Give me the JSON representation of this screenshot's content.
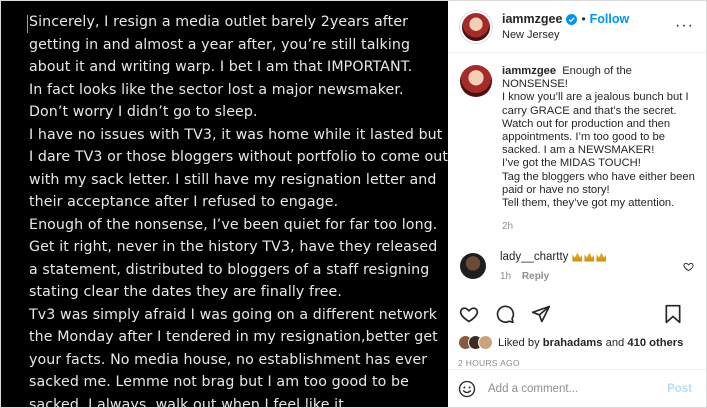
{
  "post_image": {
    "text": "Sincerely, I resign a media outlet barely 2years after getting in and almost a year after, you’re still talking about it and writing warp. I bet I am that IMPORTANT.\nIn fact looks like the sector lost a major newsmaker.\nDon’t worry I didn’t go to sleep.\nI have no issues with TV3, it was home while it lasted but I dare TV3 or those bloggers without portfolio to come out with my sack letter. I still have my resignation letter and their acceptance after I refused to engage.\nEnough of the nonsense, I’ve been quiet for far too long. Get it right, never in the history TV3, have they released a statement, distributed to bloggers of a staff resigning stating clear the dates they are finally free.\nTv3 was simply afraid I was going on a different network the Monday after I tendered in my resignation,better get your facts. No media house, no establishment has ever sacked me. Lemme not brag but I am too good to be sacked. I always, walk out when I feel like it."
  },
  "header": {
    "username": "iammzgee",
    "separator": "•",
    "follow_label": "Follow",
    "location": "New Jersey",
    "more_label": "···"
  },
  "caption": {
    "username": "iammzgee",
    "text": "Enough of the NONSENSE!\nI know you’ll are a jealous bunch but I carry GRACE and that’s the secret.\nWatch out for production and then appointments. I’m too good to be sacked. I am a NEWSMAKER!\nI’ve got the MIDAS TOUCH!\nTag the bloggers who have either been paid or have no story!\nTell them, they’ve got my attention.",
    "time": "2h"
  },
  "comment": {
    "username": "lady__chartty",
    "time": "1h",
    "reply_label": "Reply"
  },
  "likes": {
    "prefix": "Liked by ",
    "user": "brahadams",
    "middle": " and ",
    "count": "410 others"
  },
  "post_date": "2 HOURS AGO",
  "add_comment": {
    "placeholder": "Add a comment...",
    "post_label": "Post"
  },
  "colors": {
    "accent": "#0095f6",
    "media_bg": "#000000",
    "muted": "#8e8e8e"
  },
  "icons": [
    "verified-badge-icon",
    "more-options-icon",
    "heart-icon",
    "comment-icon",
    "share-icon",
    "bookmark-icon",
    "emoji-icon",
    "crown-emoji-icon"
  ]
}
